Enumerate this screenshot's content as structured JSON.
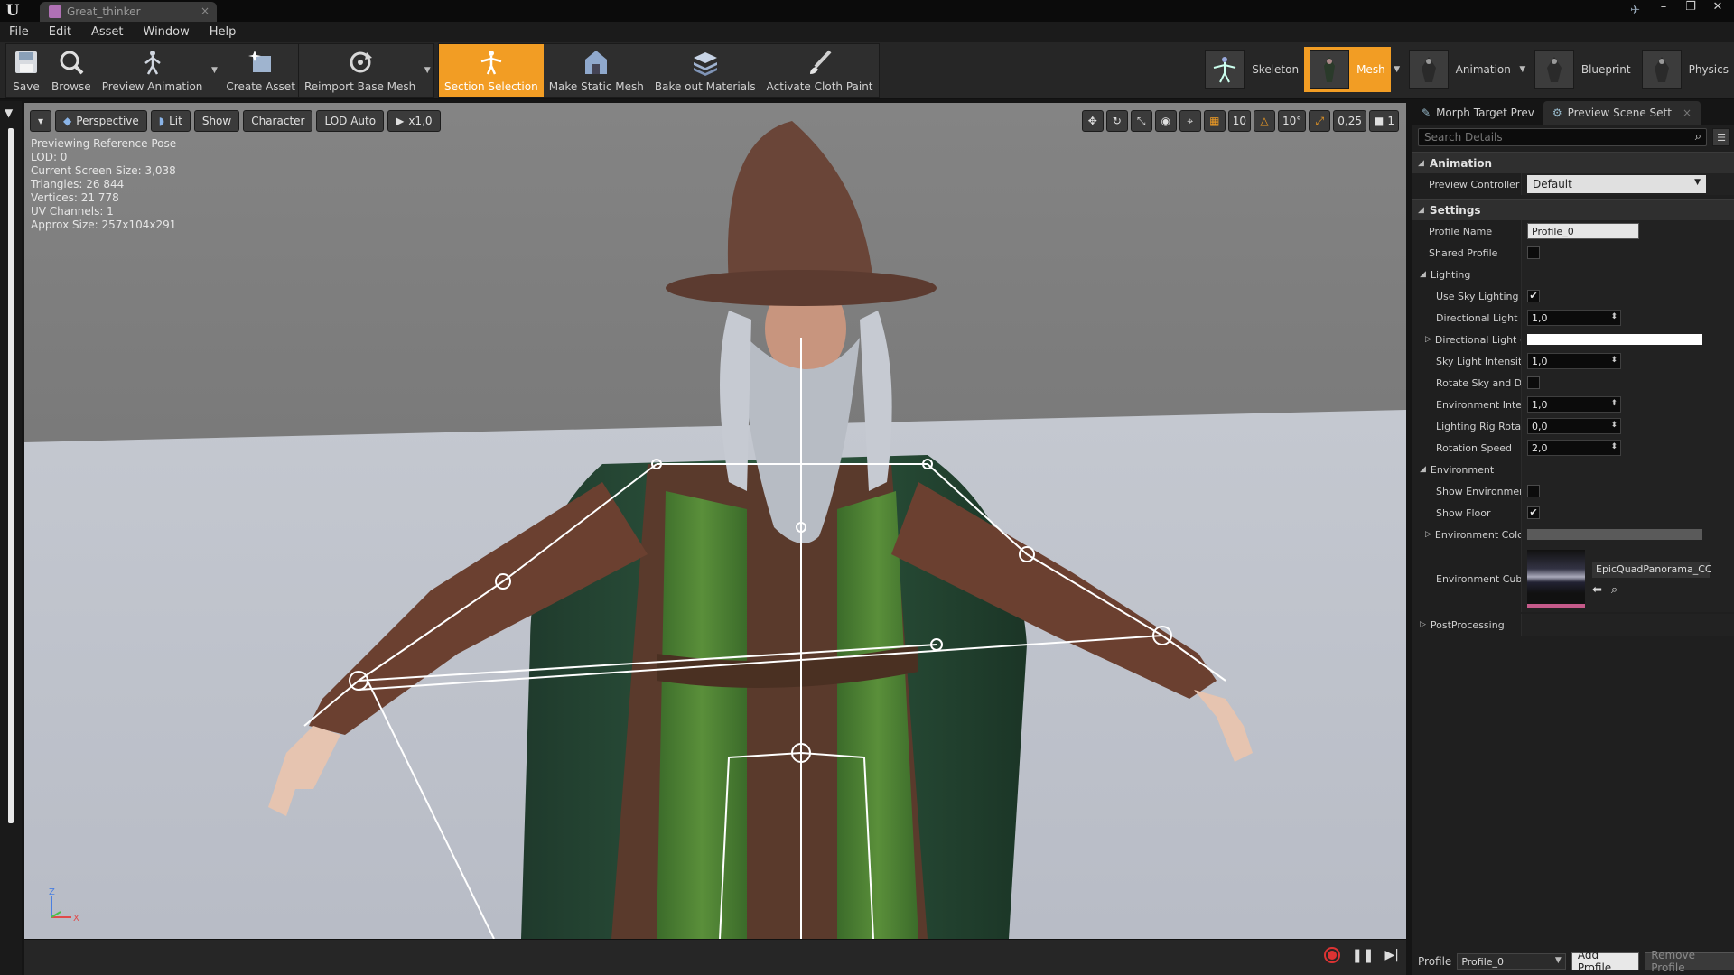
{
  "window": {
    "doc_tab_label": "Great_thinker",
    "close_glyph": "×",
    "min_glyph": "–",
    "max_glyph": "❐",
    "winclose_glyph": "✕"
  },
  "menu": [
    "File",
    "Edit",
    "Asset",
    "Window",
    "Help"
  ],
  "toolbar": {
    "buttons": [
      {
        "label": "Save",
        "icon": "save-icon"
      },
      {
        "label": "Browse",
        "icon": "browse-icon"
      },
      {
        "label": "Preview Animation",
        "icon": "preview-animation-icon"
      },
      {
        "label": "Create Asset",
        "icon": "create-asset-icon"
      },
      {
        "label": "Reimport Base Mesh",
        "icon": "reimport-icon"
      },
      {
        "label": "Section Selection",
        "icon": "section-selection-icon",
        "active": true
      },
      {
        "label": "Make Static Mesh",
        "icon": "static-mesh-icon"
      },
      {
        "label": "Bake out Materials",
        "icon": "bake-materials-icon"
      },
      {
        "label": "Activate Cloth Paint",
        "icon": "cloth-paint-icon"
      }
    ],
    "drop_glyph": "▼"
  },
  "modes": [
    {
      "label": "Skeleton"
    },
    {
      "label": "Mesh",
      "active": true
    },
    {
      "label": "Animation"
    },
    {
      "label": "Blueprint"
    },
    {
      "label": "Physics"
    }
  ],
  "viewport": {
    "perspective": "Perspective",
    "lit": "Lit",
    "show": "Show",
    "character": "Character",
    "lod": "LOD Auto",
    "speed": "x1,0",
    "grid_snap": "10",
    "rot_snap": "10°",
    "scale_snap": "0,25",
    "cam_speed": "1",
    "stats": [
      "Previewing Reference Pose",
      "LOD: 0",
      "Current Screen Size: 3,038",
      "Triangles: 26 844",
      "Vertices: 21 778",
      "UV Channels: 1",
      "Approx Size: 257x104x291"
    ],
    "axis_z": "Z",
    "axis_x": "X"
  },
  "panel": {
    "tabs": [
      {
        "label": "Morph Target Prev"
      },
      {
        "label": "Preview Scene Sett",
        "active": true
      }
    ],
    "search_placeholder": "Search Details",
    "animation_cat": "Animation",
    "preview_controller_label": "Preview Controller",
    "preview_controller_value": "Default",
    "settings_cat": "Settings",
    "profile_name_label": "Profile Name",
    "profile_name_value": "Profile_0",
    "shared_profile_label": "Shared Profile",
    "lighting_cat": "Lighting",
    "use_sky_lighting_label": "Use Sky Lighting",
    "dir_light_int_label": "Directional Light I",
    "dir_light_int_value": "1,0",
    "dir_light_col_label": "Directional Light (",
    "sky_light_int_label": "Sky Light Intensity",
    "sky_light_int_value": "1,0",
    "rotate_sky_label": "Rotate Sky and Di",
    "env_intensity_label": "Environment Inten",
    "env_intensity_value": "1,0",
    "rig_rotation_label": "Lighting Rig Rotat",
    "rig_rotation_value": "0,0",
    "rotation_speed_label": "Rotation Speed",
    "rotation_speed_value": "2,0",
    "environment_cat": "Environment",
    "show_env_label": "Show Environmen",
    "show_floor_label": "Show Floor",
    "env_color_label": "Environment Colo",
    "env_cube_label": "Environment Cube",
    "env_cube_asset": "EpicQuadPanorama_CC",
    "postprocessing_cat": "PostProcessing",
    "profile_label": "Profile",
    "profile_value": "Profile_0",
    "add_profile": "Add Profile",
    "remove_profile": "Remove Profile",
    "check_glyph": "✔",
    "spin_glyph": "⬍",
    "expand_glyph": "◢",
    "collapsed_glyph": "▷"
  },
  "colors": {
    "accent": "#f29d24",
    "dir_light_color": "#ffffff",
    "env_color": "#5a5a5a"
  }
}
